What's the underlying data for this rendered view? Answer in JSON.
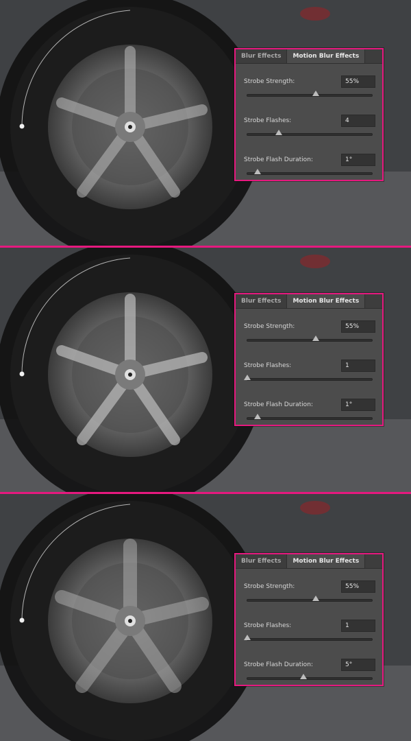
{
  "tabs": [
    "Blur Effects",
    "Motion Blur Effects"
  ],
  "active_tab": 1,
  "accent_color": "#e6197f",
  "frames": [
    {
      "strength_label": "Strobe Strength:",
      "strength_value": "55%",
      "strength_level": 0.55,
      "flashes_label": "Strobe Flashes:",
      "flashes_value": "4",
      "flashes_level": 0.25,
      "duration_label": "Strobe Flash Duration:",
      "duration_value": "1°",
      "duration_level": 0.08
    },
    {
      "strength_label": "Strobe Strength:",
      "strength_value": "55%",
      "strength_level": 0.55,
      "flashes_label": "Strobe Flashes:",
      "flashes_value": "1",
      "flashes_level": 0.0,
      "duration_label": "Strobe Flash Duration:",
      "duration_value": "1°",
      "duration_level": 0.08
    },
    {
      "strength_label": "Strobe Strength:",
      "strength_value": "55%",
      "strength_level": 0.55,
      "flashes_label": "Strobe Flashes:",
      "flashes_value": "1",
      "flashes_level": 0.0,
      "duration_label": "Strobe Flash Duration:",
      "duration_value": "5°",
      "duration_level": 0.45
    }
  ]
}
